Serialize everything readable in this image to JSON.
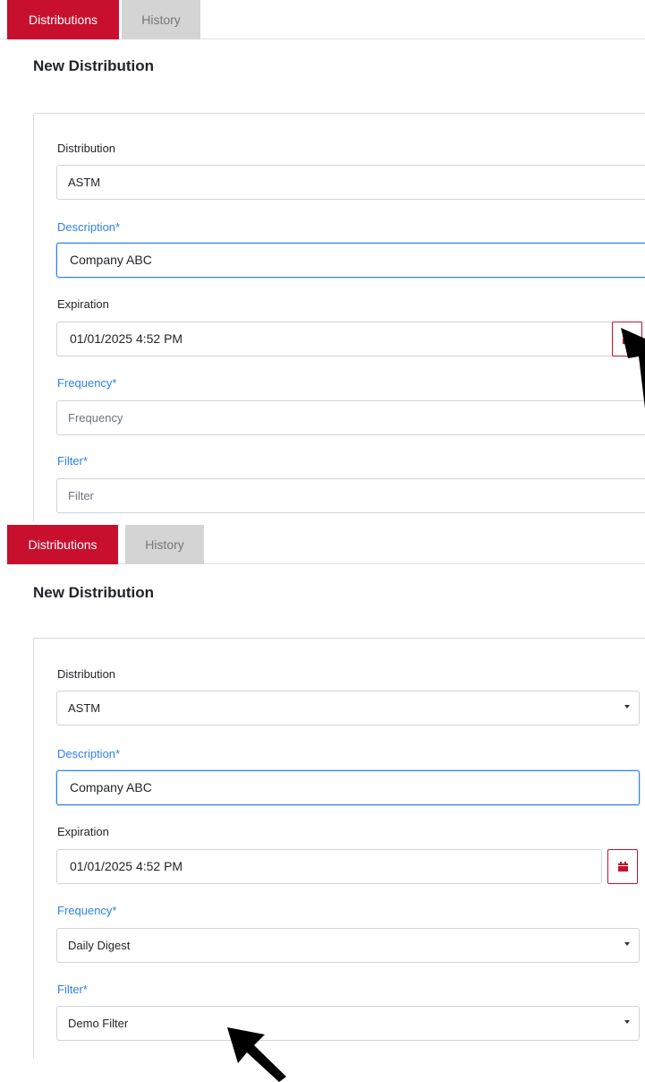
{
  "panels": [
    {
      "tabs": {
        "distributions": "Distributions",
        "history": "History"
      },
      "title": "New Distribution",
      "form": {
        "distribution_label": "Distribution",
        "distribution_value": "ASTM",
        "description_label": "Description*",
        "description_value": "Company ABC",
        "expiration_label": "Expiration",
        "expiration_value": "01/01/2025 4:52 PM",
        "frequency_label": "Frequency*",
        "frequency_placeholder": "Frequency",
        "filter_label": "Filter*",
        "filter_placeholder": "Filter"
      }
    },
    {
      "tabs": {
        "distributions": "Distributions",
        "history": "History"
      },
      "title": "New Distribution",
      "form": {
        "distribution_label": "Distribution",
        "distribution_value": "ASTM",
        "description_label": "Description*",
        "description_value": "Company ABC",
        "expiration_label": "Expiration",
        "expiration_value": "01/01/2025 4:52 PM",
        "frequency_label": "Frequency*",
        "frequency_value": "Daily Digest",
        "filter_label": "Filter*",
        "filter_value": "Demo Filter"
      }
    }
  ],
  "icons": {
    "calendar": "calendar-icon",
    "pointer": "mouse-pointer-icon"
  },
  "colors": {
    "accent": "#c8102e",
    "required_label": "#2f80ed",
    "inactive_tab": "#d4d4d4"
  }
}
